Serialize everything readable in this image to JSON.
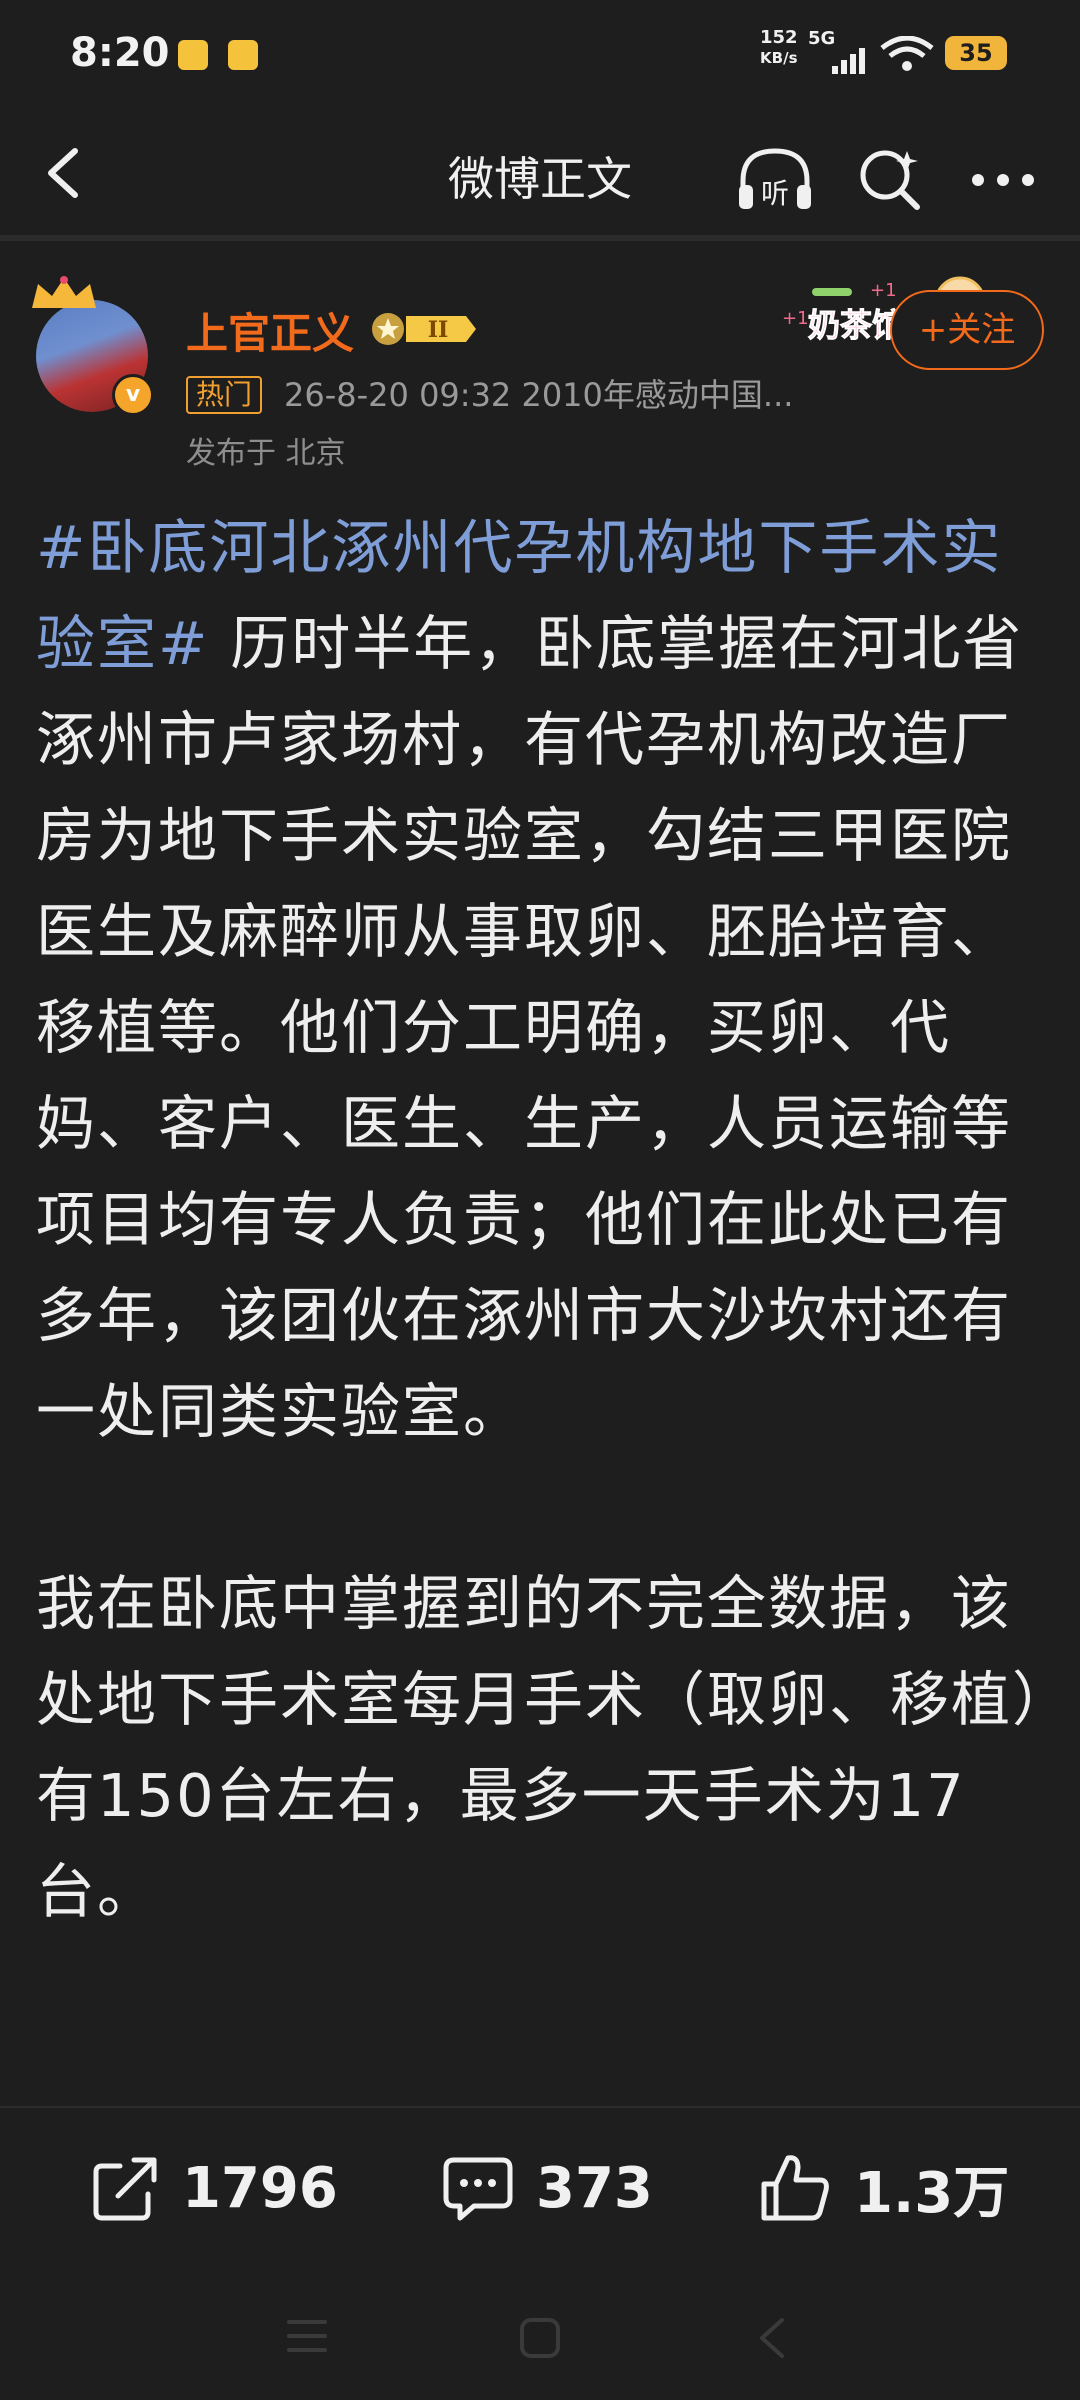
{
  "status_bar": {
    "time": "8:20",
    "net_speed_value": "152",
    "net_speed_unit": "KB/s",
    "network": "5G",
    "battery": "35"
  },
  "nav": {
    "title": "微博正文",
    "listen_label": "听"
  },
  "author": {
    "name": "上官正义",
    "level": "II",
    "hot_tag": "热门",
    "meta": "26-8-20 09:32  2010年感动中国...",
    "location": "发布于 北京",
    "follow_label": "+关注",
    "verified_mark": "v",
    "sticker_text": "奶茶馆",
    "sticker_plus": "+1"
  },
  "post": {
    "hashtag": "#卧底河北涿州代孕机构地下手术实验室#",
    "paragraph1": " 历时半年，卧底掌握在河北省涿州市卢家场村，有代孕机构改造厂房为地下手术实验室，勾结三甲医院医生及麻醉师从事取卵、胚胎培育、移植等。他们分工明确，买卵、代妈、客户、医生、生产，人员运输等项目均有专人负责；他们在此处已有多年，该团伙在涿州市大沙坎村还有一处同类实验室。",
    "paragraph2": "我在卧底中掌握到的不完全数据，该处地下手术室每月手术（取卵、移植）有150台左右，最多一天手术为17台。"
  },
  "actions": {
    "repost_count": "1796",
    "comment_count": "373",
    "like_count": "1.3万"
  },
  "colors": {
    "background": "#1e1e1e",
    "accent_orange": "#f26a1b",
    "hashtag_blue": "#7f9ed8",
    "battery": "#f0b53a"
  }
}
